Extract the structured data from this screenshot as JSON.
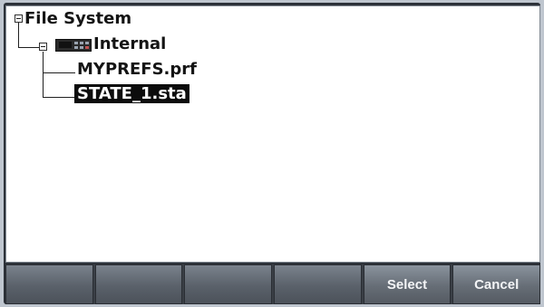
{
  "tree": {
    "root": {
      "label": "File System",
      "expander": "minus"
    },
    "drive": {
      "label": "Internal",
      "expander": "minus",
      "icon": "drive-icon"
    },
    "files": [
      {
        "label": "MYPREFS.prf",
        "selected": false
      },
      {
        "label": "STATE_1.sta",
        "selected": true
      }
    ]
  },
  "softkeys": [
    "",
    "",
    "",
    "",
    "Select",
    "Cancel"
  ],
  "colors": {
    "selection_bg": "#0c0c0c",
    "softkey": "#5a616a"
  }
}
